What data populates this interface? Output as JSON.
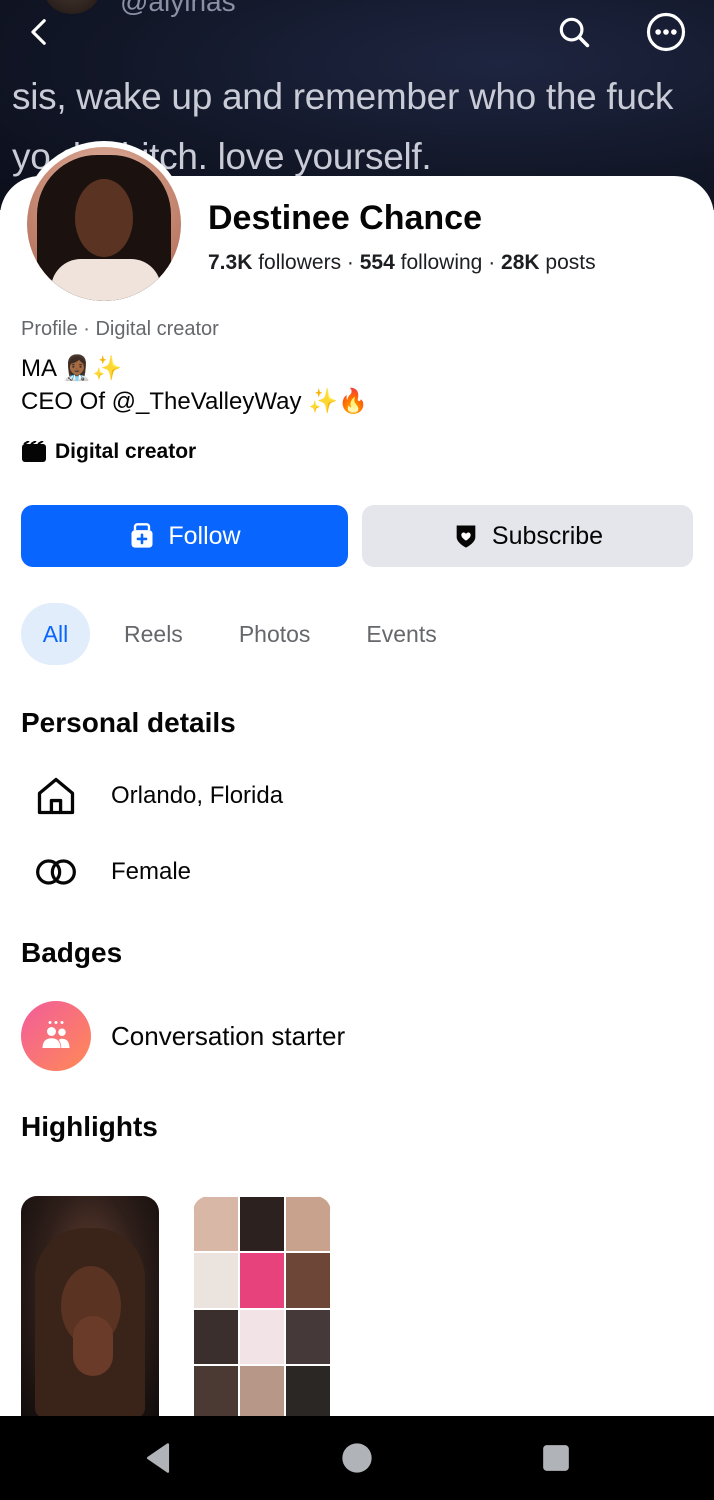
{
  "cover": {
    "handle": "@alyinas",
    "line1": "sis, wake up and remember who the fuck",
    "line2": "yo       dat bitch. love yourself."
  },
  "top_bar": {
    "back_icon": "chevron-left-icon",
    "search_icon": "search-icon",
    "more_icon": "more-horizontal-icon"
  },
  "profile": {
    "name": "Destinee Chance",
    "followers_count": "7.3K",
    "followers_label": "followers",
    "following_count": "554",
    "following_label": "following",
    "posts_count": "28K",
    "posts_label": "posts",
    "sep": " · ",
    "category_line": "Profile · Digital creator",
    "bio_line1": "MA 👩🏾‍⚕️✨",
    "bio_line2": "CEO  Of @_TheValleyWay ✨🔥",
    "creator_label": "Digital creator"
  },
  "actions": {
    "follow_label": "Follow",
    "subscribe_label": "Subscribe"
  },
  "tabs": [
    {
      "label": "All",
      "active": true
    },
    {
      "label": "Reels",
      "active": false
    },
    {
      "label": "Photos",
      "active": false
    },
    {
      "label": "Events",
      "active": false
    }
  ],
  "personal_details": {
    "title": "Personal details",
    "location": "Orlando, Florida",
    "gender": "Female"
  },
  "badges": {
    "title": "Badges",
    "items": [
      {
        "label": "Conversation starter"
      }
    ]
  },
  "highlights": {
    "title": "Highlights"
  },
  "colors": {
    "primary": "#0866ff",
    "secondary_button": "#e4e6eb",
    "active_tab_bg": "#e1edfb",
    "muted_text": "#65676b"
  }
}
